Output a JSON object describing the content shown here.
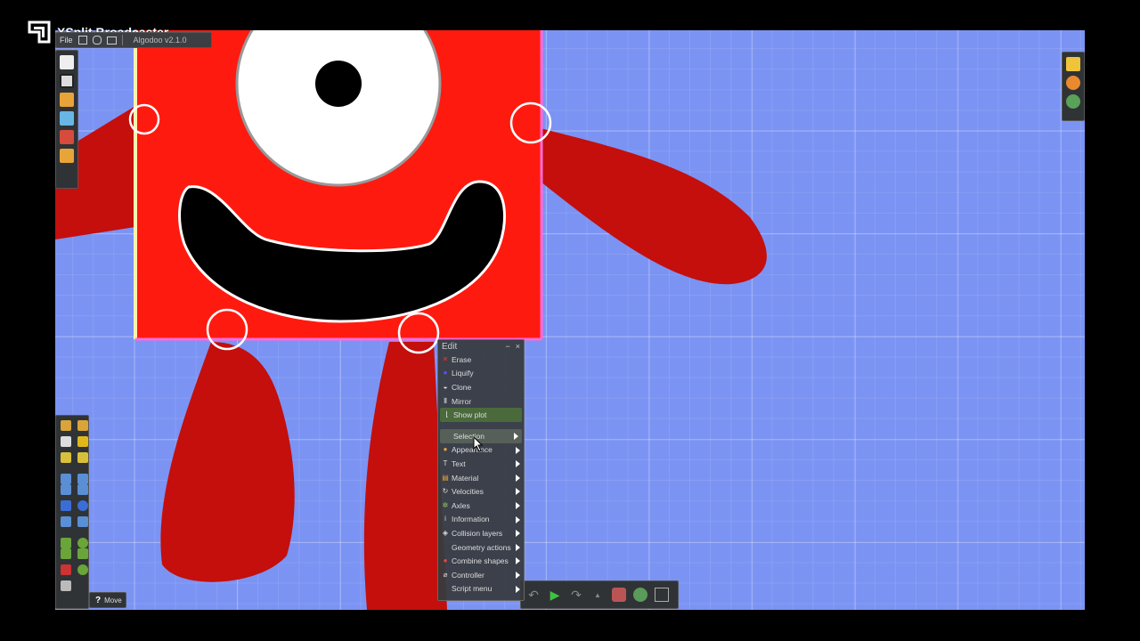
{
  "app": {
    "brand": "XSplit Broadcaster"
  },
  "topbar": {
    "file_label": "File",
    "version": "Algodoo v2.1.0"
  },
  "menu": {
    "title": "Edit",
    "items": [
      {
        "label": "Erase",
        "icon": "erase-icon",
        "submenu": false
      },
      {
        "label": "Liquify",
        "icon": "liquify-icon",
        "submenu": false
      },
      {
        "label": "Clone",
        "icon": "clone-icon",
        "submenu": false
      },
      {
        "label": "Mirror",
        "icon": "mirror-icon",
        "submenu": false
      },
      {
        "label": "Show plot",
        "icon": "plot-icon",
        "submenu": false
      }
    ],
    "submenus": [
      {
        "label": "Selection",
        "icon": "selection-icon"
      },
      {
        "label": "Appearance",
        "icon": "appearance-icon"
      },
      {
        "label": "Text",
        "icon": "text-icon"
      },
      {
        "label": "Material",
        "icon": "material-icon"
      },
      {
        "label": "Velocities",
        "icon": "velocities-icon"
      },
      {
        "label": "Axles",
        "icon": "axles-icon"
      },
      {
        "label": "Information",
        "icon": "information-icon"
      },
      {
        "label": "Collision layers",
        "icon": "collision-layers-icon"
      },
      {
        "label": "Geometry actions",
        "icon": "geometry-actions-icon"
      },
      {
        "label": "Combine shapes",
        "icon": "combine-shapes-icon"
      },
      {
        "label": "Controller",
        "icon": "controller-icon"
      },
      {
        "label": "Script menu",
        "icon": "script-menu-icon"
      }
    ]
  },
  "statusbar": {
    "tool_name": "Move",
    "tool_key": "?"
  },
  "colors": {
    "canvas": "#7b93f3",
    "body": "#ff1a10",
    "limb": "#c40f0c",
    "menu_highlight": "#4b6a3c",
    "play": "#3fc43f"
  }
}
